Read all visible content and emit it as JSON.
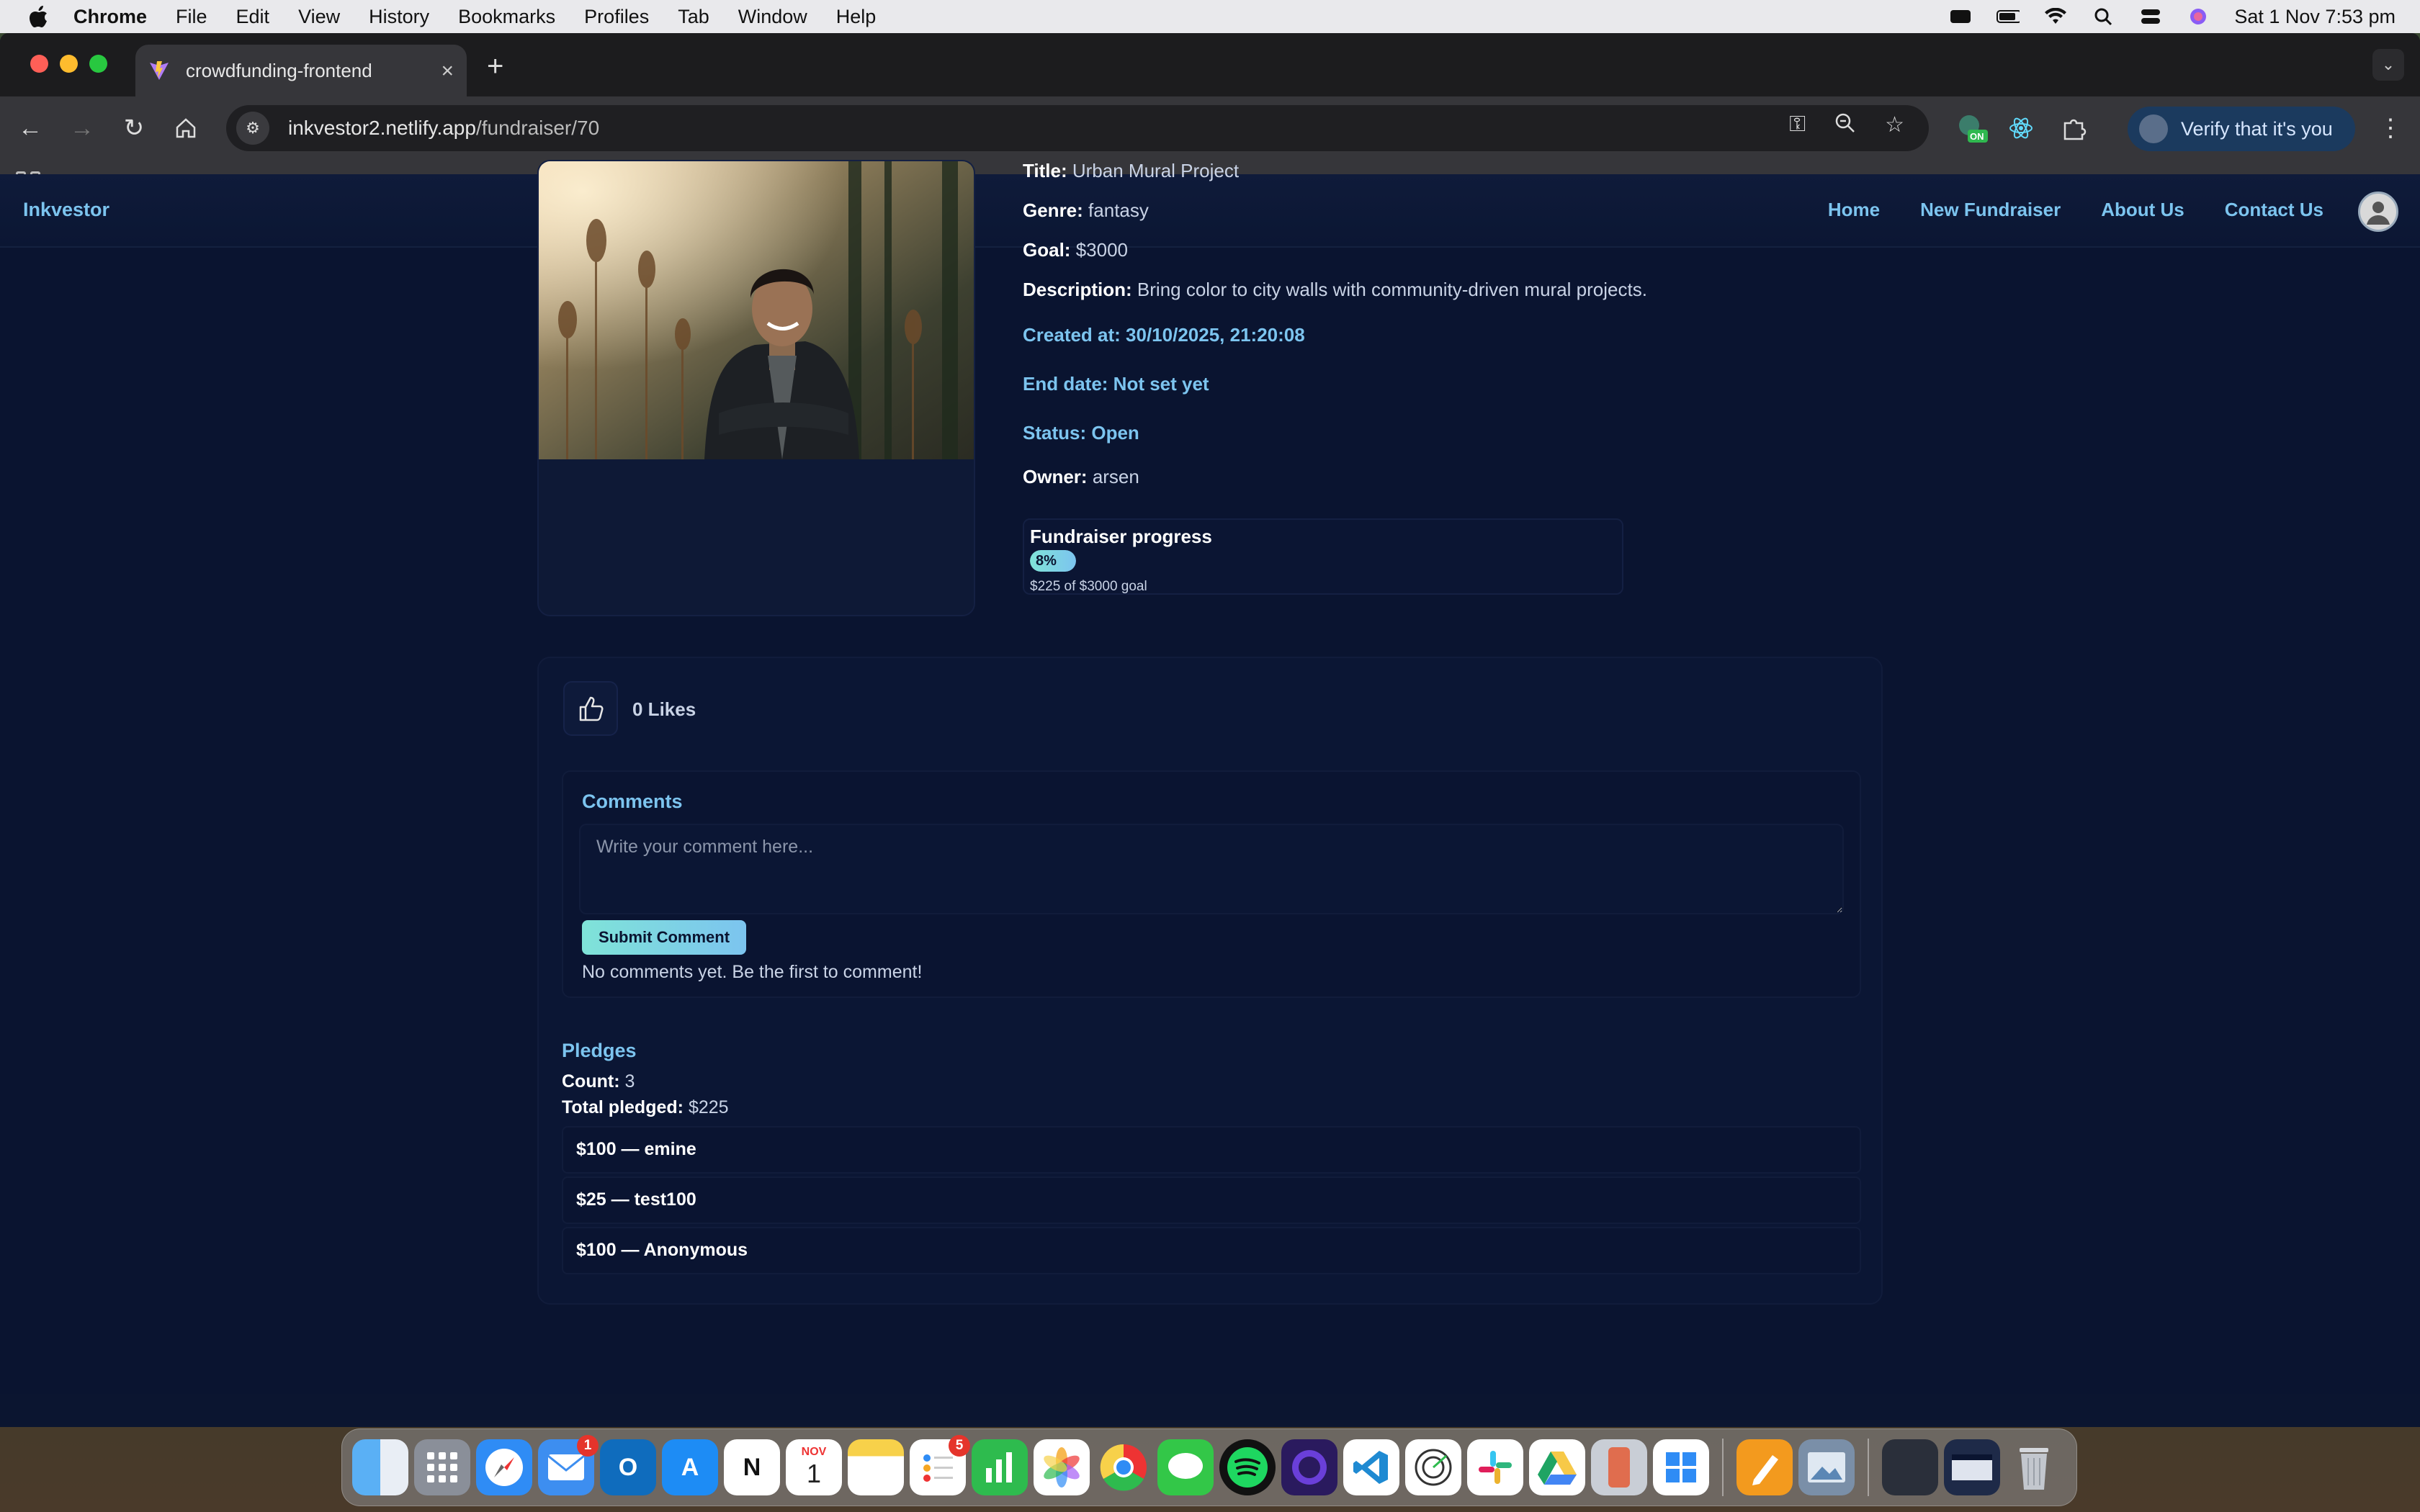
{
  "menubar": {
    "app": "Chrome",
    "items": [
      "File",
      "Edit",
      "View",
      "History",
      "Bookmarks",
      "Profiles",
      "Tab",
      "Window",
      "Help"
    ],
    "datetime": "Sat 1 Nov  7:53 pm"
  },
  "browser": {
    "tab_title": "crowdfunding-frontend",
    "url_host": "inkvestor2.netlify.app",
    "url_path": "/fundraiser/70",
    "verify_label": "Verify that it's you"
  },
  "site": {
    "brand": "Inkvestor",
    "nav": [
      "Home",
      "New Fundraiser",
      "About Us",
      "Contact Us"
    ]
  },
  "fundraiser": {
    "title_label": "Title:",
    "title": "Urban Mural Project",
    "genre_label": "Genre:",
    "genre": "fantasy",
    "goal_label": "Goal:",
    "goal": "$3000",
    "description_label": "Description:",
    "description": "Bring color to city walls with community-driven mural projects.",
    "created": "Created at: 30/10/2025, 21:20:08",
    "end_date": "End date: Not set yet",
    "status": "Status: Open",
    "owner_label": "Owner:",
    "owner": "arsen",
    "progress_title": "Fundraiser progress",
    "progress_percent_label": "8%",
    "progress_fraction": 0.08,
    "progress_note": "$225 of $3000 goal"
  },
  "social": {
    "likes": "0 Likes",
    "comments_title": "Comments",
    "comment_placeholder": "Write your comment here...",
    "submit_label": "Submit Comment",
    "no_comments": "No comments yet. Be the first to comment!"
  },
  "pledges": {
    "title": "Pledges",
    "count_label": "Count:",
    "count": "3",
    "total_label": "Total pledged:",
    "total": "$225",
    "items": [
      "$100 — emine",
      "$25 — test100",
      "$100 — Anonymous"
    ]
  },
  "dock": {
    "mail_badge": "1",
    "reminders_badge": "5",
    "calendar_month": "NOV",
    "calendar_day": "1"
  },
  "colors": {
    "accent": "#7cc4ef",
    "page_bg": "#0a1430",
    "progress_gradient_start": "#7fe3d8"
  }
}
